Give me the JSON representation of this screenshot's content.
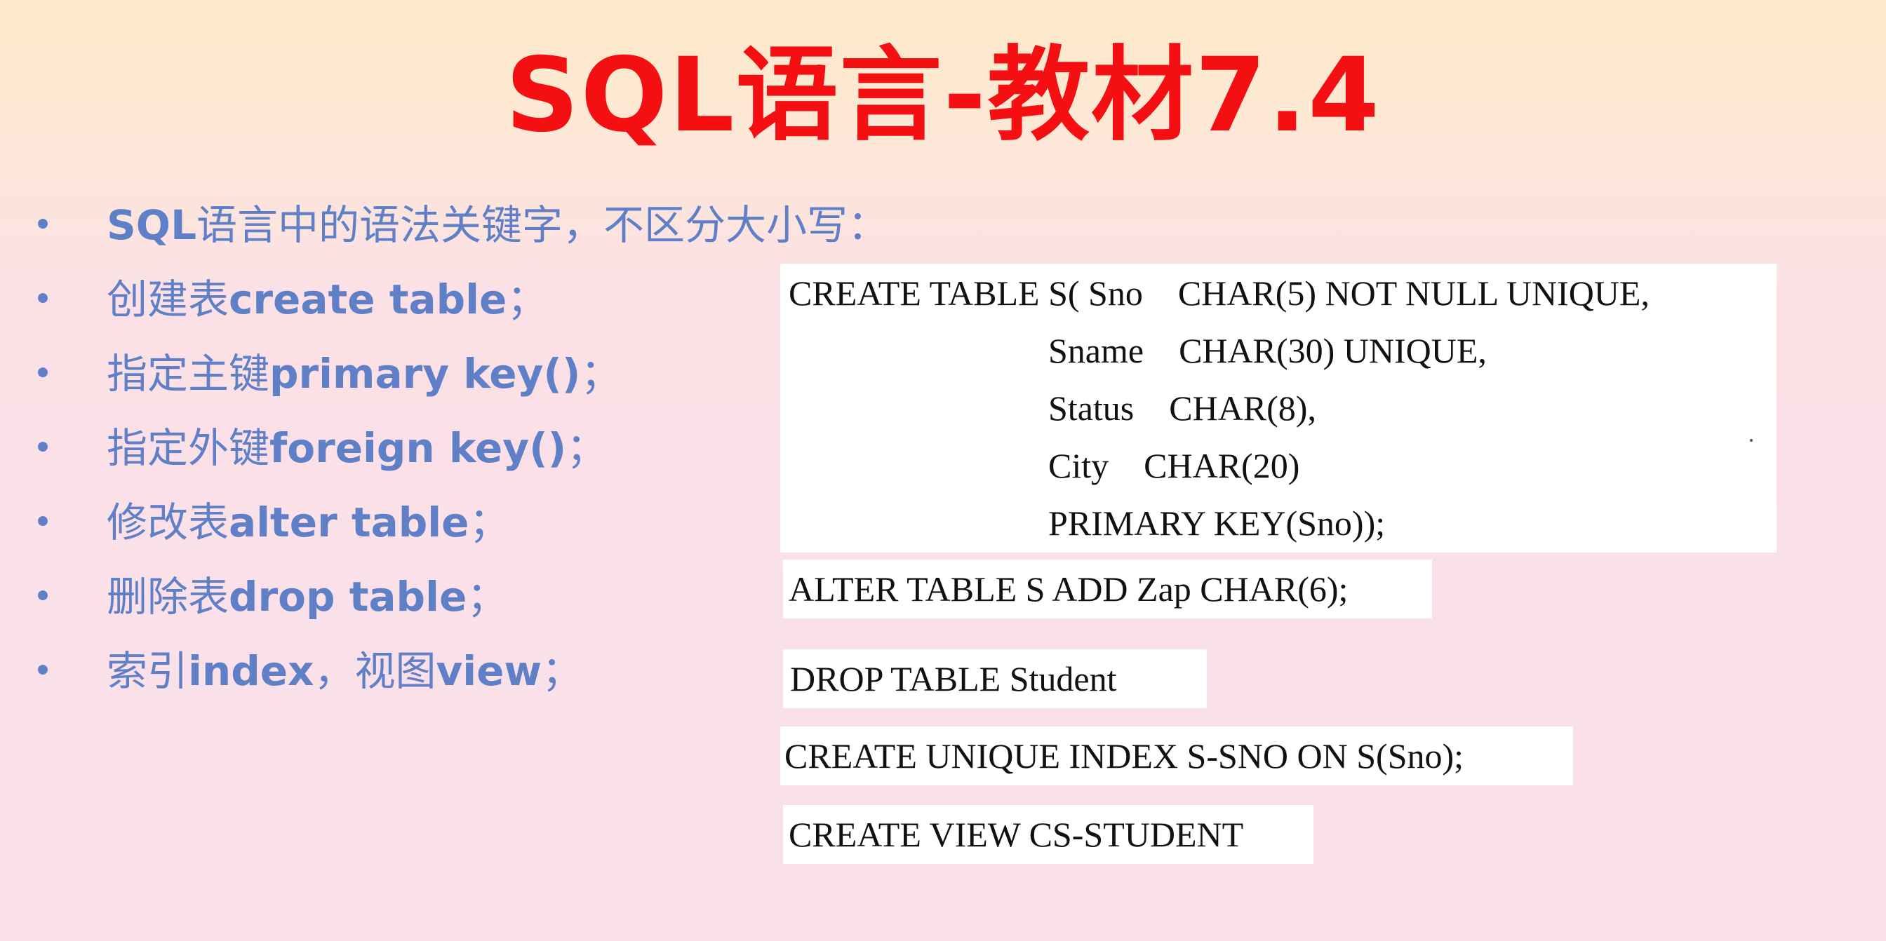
{
  "slide": {
    "title": "SQL语言-教材7.4",
    "bullets": [
      {
        "dot": "•",
        "cn": "",
        "en": "SQL",
        "tail": "语言中的语法关键字，不区分大小写："
      },
      {
        "dot": "•",
        "cn": "创建表",
        "en": "create table",
        "tail": "；"
      },
      {
        "dot": "•",
        "cn": "指定主键",
        "en": "primary key()",
        "tail": "；"
      },
      {
        "dot": "•",
        "cn": "指定外键",
        "en": "foreign key()",
        "tail": "；"
      },
      {
        "dot": "•",
        "cn": "修改表",
        "en": "alter table",
        "tail": "；"
      },
      {
        "dot": "•",
        "cn": "删除表",
        "en": "drop table",
        "tail": "；"
      },
      {
        "dot": "•",
        "cn": "索引",
        "en": "index",
        "tail": "，视图",
        "en2": "view",
        "tail2": "；"
      }
    ],
    "code": {
      "create_table": [
        "CREATE TABLE S( Sno    CHAR(5) NOT NULL UNIQUE,",
        "Sname    CHAR(30) UNIQUE,",
        "Status    CHAR(8),",
        "City    CHAR(20)",
        "PRIMARY KEY(Sno));"
      ],
      "alter_table": "ALTER TABLE S ADD Zap CHAR(6);",
      "drop_table": "DROP TABLE Student",
      "create_index": "CREATE UNIQUE INDEX S-SNO ON S(Sno);",
      "create_view": "CREATE VIEW CS-STUDENT"
    }
  }
}
